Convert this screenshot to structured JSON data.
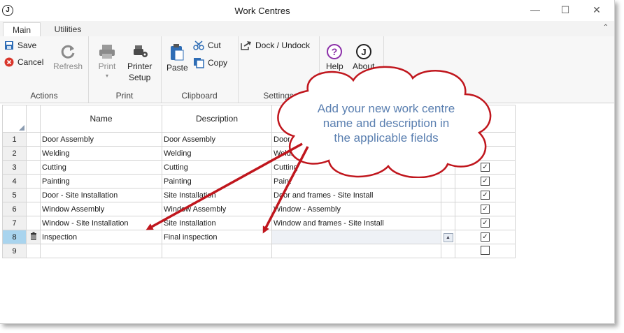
{
  "window": {
    "title": "Work Centres",
    "app_icon_letter": "J"
  },
  "tabs": [
    {
      "label": "Main",
      "active": true
    },
    {
      "label": "Utilities",
      "active": false
    }
  ],
  "ribbon": {
    "actions": {
      "save": "Save",
      "cancel": "Cancel",
      "refresh": "Refresh",
      "group": "Actions"
    },
    "print": {
      "print": "Print",
      "printer_setup_line1": "Printer",
      "printer_setup_line2": "Setup",
      "group": "Print"
    },
    "clipboard": {
      "paste": "Paste",
      "cut": "Cut",
      "copy": "Copy",
      "group": "Clipboard"
    },
    "settings": {
      "dock": "Dock / Undock",
      "group": "Settings"
    },
    "help": {
      "help": "Help",
      "about": "About"
    }
  },
  "grid": {
    "columns": [
      "Name",
      "Description"
    ],
    "rows": [
      {
        "num": "1",
        "name": "Door Assembly",
        "description": "Door Assembly",
        "extra": "Door Assembly",
        "checked": false
      },
      {
        "num": "2",
        "name": "Welding",
        "description": "Welding",
        "extra": "Welding",
        "checked": false
      },
      {
        "num": "3",
        "name": "Cutting",
        "description": "Cutting",
        "extra": "Cutting",
        "checked": true
      },
      {
        "num": "4",
        "name": "Painting",
        "description": "Painting",
        "extra": "Paint",
        "checked": true
      },
      {
        "num": "5",
        "name": "Door - Site Installation",
        "description": "Site Installation",
        "extra": "Door and frames - Site Install",
        "checked": true
      },
      {
        "num": "6",
        "name": "Window Assembly",
        "description": "Window Assembly",
        "extra": "Window - Assembly",
        "checked": true
      },
      {
        "num": "7",
        "name": "Window - Site Installation",
        "description": "Site Installation",
        "extra": "Window and frames - Site Install",
        "checked": true
      },
      {
        "num": "8",
        "name": "Inspection",
        "description": "Final inspection",
        "extra": "",
        "checked": true,
        "selected": true
      },
      {
        "num": "9",
        "name": "",
        "description": "",
        "extra": "",
        "checked": false
      }
    ]
  },
  "callout": {
    "line1": "Add your new work centre",
    "line2": "name and description in",
    "line3": "the applicable fields"
  },
  "colors": {
    "arrow": "#c0161d",
    "callout_text": "#5a7fb0",
    "selected_row": "#a9d4ee"
  }
}
